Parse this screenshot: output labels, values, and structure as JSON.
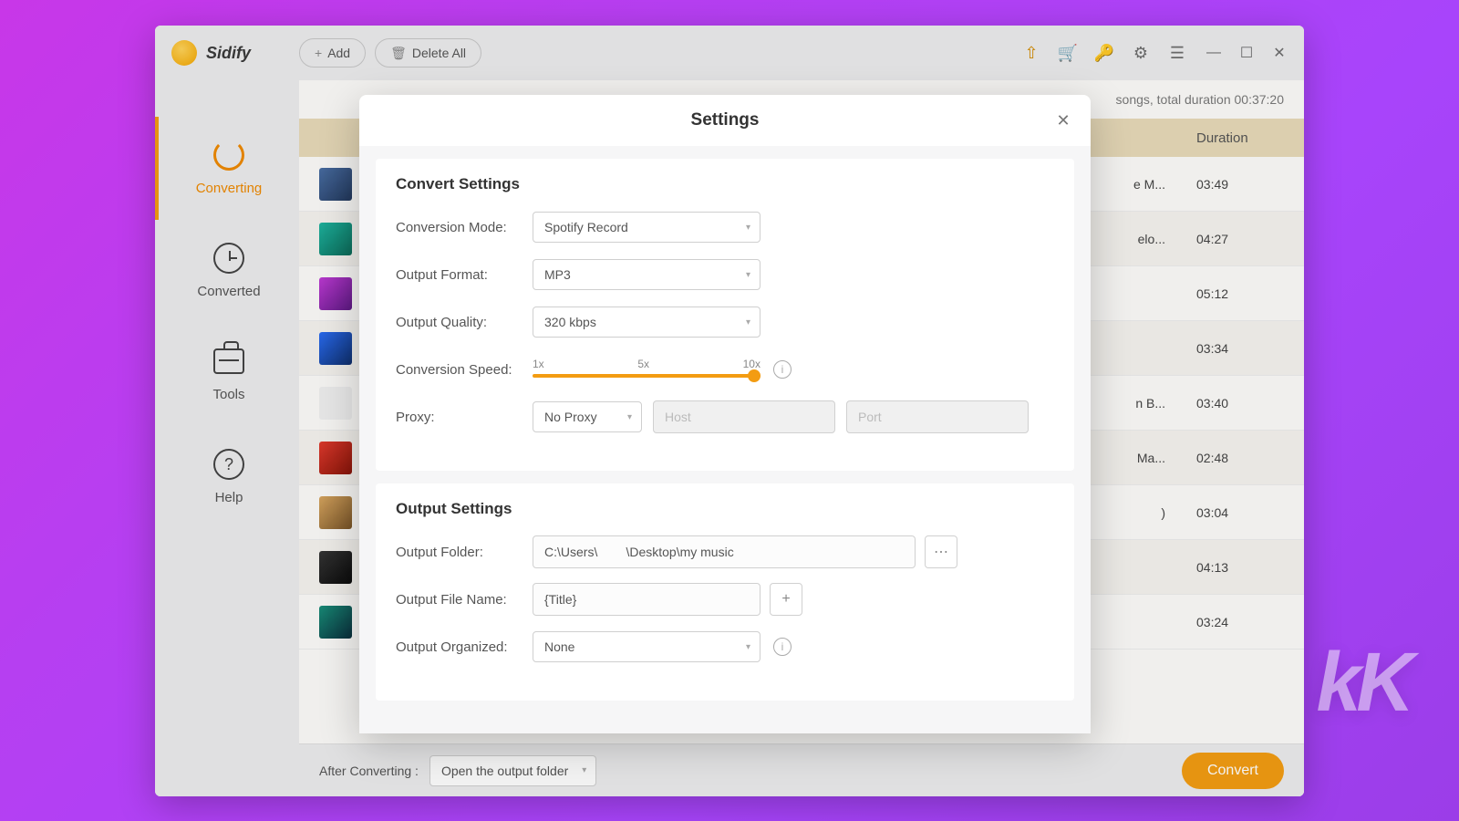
{
  "brand": {
    "name": "Sidify"
  },
  "toolbar": {
    "add": "Add",
    "delete_all": "Delete All"
  },
  "sidebar": {
    "items": [
      {
        "label": "Converting"
      },
      {
        "label": "Converted"
      },
      {
        "label": "Tools"
      },
      {
        "label": "Help"
      }
    ]
  },
  "summary": "songs, total duration 00:37:20",
  "table": {
    "duration_header": "Duration",
    "rows": [
      {
        "album": "e M...",
        "duration": "03:49"
      },
      {
        "album": "elo...",
        "duration": "04:27"
      },
      {
        "album": "",
        "duration": "05:12"
      },
      {
        "album": "",
        "duration": "03:34"
      },
      {
        "album": "n B...",
        "duration": "03:40"
      },
      {
        "album": "Ma...",
        "duration": "02:48"
      },
      {
        "album": ")",
        "duration": "03:04"
      },
      {
        "album": "",
        "duration": "04:13"
      },
      {
        "album": "",
        "duration": "03:24"
      }
    ]
  },
  "footer": {
    "label": "After Converting :",
    "after_value": "Open the output folder",
    "convert": "Convert"
  },
  "modal": {
    "title": "Settings",
    "convert_heading": "Convert Settings",
    "conversion_mode_label": "Conversion Mode:",
    "conversion_mode_value": "Spotify Record",
    "output_format_label": "Output Format:",
    "output_format_value": "MP3",
    "output_quality_label": "Output Quality:",
    "output_quality_value": "320 kbps",
    "conversion_speed_label": "Conversion Speed:",
    "speed": {
      "min": "1x",
      "mid": "5x",
      "max": "10x"
    },
    "proxy_label": "Proxy:",
    "proxy_value": "No Proxy",
    "proxy_host_ph": "Host",
    "proxy_port_ph": "Port",
    "output_heading": "Output Settings",
    "output_folder_label": "Output Folder:",
    "output_folder_value": "C:\\Users\\        \\Desktop\\my music",
    "output_filename_label": "Output File Name:",
    "output_filename_value": "{Title}",
    "output_organized_label": "Output Organized:",
    "output_organized_value": "None"
  },
  "colors": {
    "accent": "#f39c12"
  }
}
